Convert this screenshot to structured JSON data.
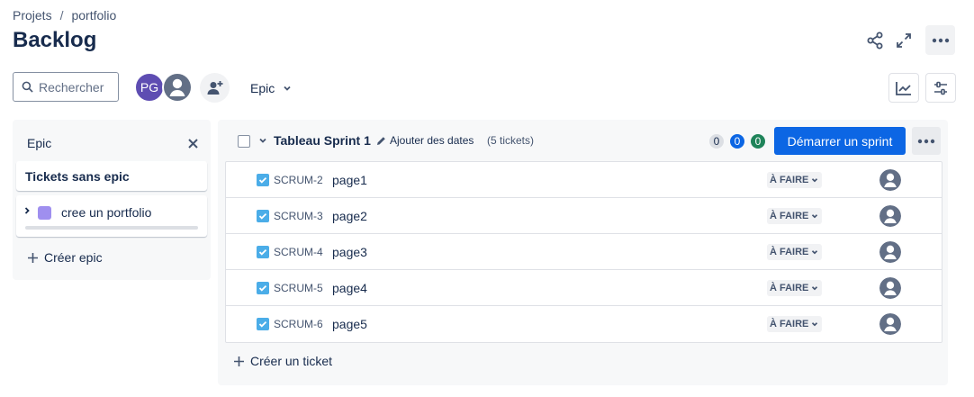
{
  "breadcrumb": {
    "project": "Projets",
    "separator": "/",
    "current": "portfolio"
  },
  "page": {
    "title": "Backlog"
  },
  "toolbar": {
    "search_placeholder": "Rechercher",
    "avatar_initials": "PG",
    "epic_filter_label": "Epic",
    "icons": [
      "share-icon",
      "fullscreen-icon",
      "more-icon",
      "search-icon",
      "add-person-icon",
      "chevron-down-icon",
      "insights-icon",
      "settings-icon"
    ]
  },
  "epic_panel": {
    "title": "Epic",
    "no_epic_label": "Tickets sans epic",
    "epics": [
      {
        "name": "cree un portfolio",
        "color": "#9f8fef"
      }
    ],
    "create_label": "Créer epic"
  },
  "sprint": {
    "name": "Tableau Sprint 1",
    "add_dates_label": "Ajouter des dates",
    "ticket_count_label": "(5 tickets)",
    "counts": {
      "todo": "0",
      "in_progress": "0",
      "done": "0"
    },
    "start_button_label": "Démarrer un sprint",
    "issues": [
      {
        "key": "SCRUM-2",
        "summary": "page1",
        "status": "À FAIRE"
      },
      {
        "key": "SCRUM-3",
        "summary": "page2",
        "status": "À FAIRE"
      },
      {
        "key": "SCRUM-4",
        "summary": "page3",
        "status": "À FAIRE"
      },
      {
        "key": "SCRUM-5",
        "summary": "page4",
        "status": "À FAIRE"
      },
      {
        "key": "SCRUM-6",
        "summary": "page5",
        "status": "À FAIRE"
      }
    ],
    "create_ticket_label": "Créer un ticket"
  },
  "colors": {
    "primary": "#0c66e4",
    "task": "#4bade8",
    "done": "#1f845a",
    "avatar_pg": "#5e4db2"
  }
}
